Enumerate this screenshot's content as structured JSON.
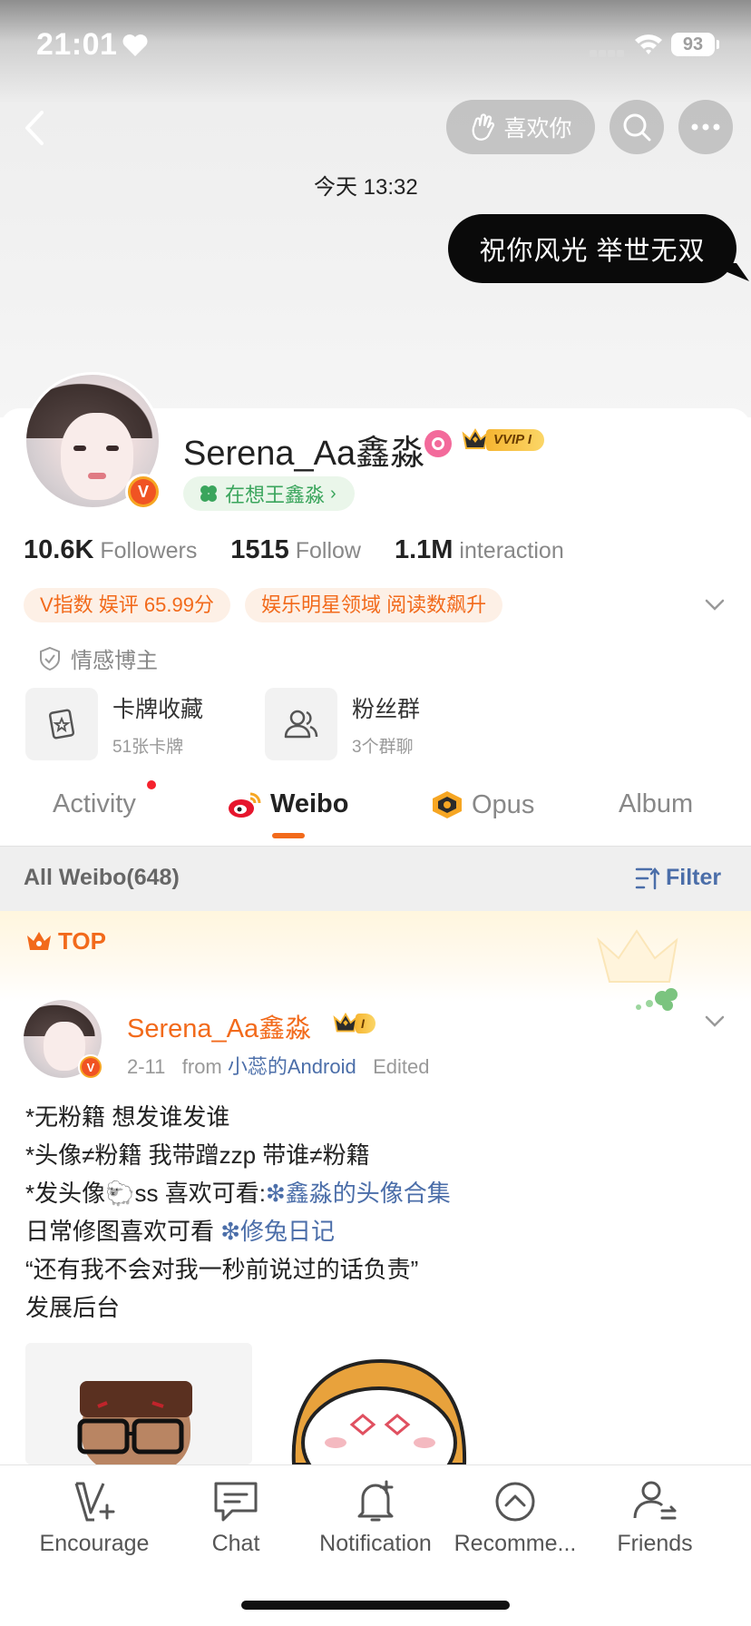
{
  "status_bar": {
    "time": "21:01",
    "battery": "93"
  },
  "nav": {
    "like_label": "喜欢你"
  },
  "chat": {
    "timestamp": "今天 13:32",
    "message": "祝你风光 举世无双"
  },
  "profile": {
    "name": "Serena_Aa鑫淼",
    "vip_label": "VVIP",
    "vip_level": "I",
    "thinking_label": "在想王鑫淼",
    "stats": [
      {
        "value": "10.6K",
        "label": "Followers"
      },
      {
        "value": "1515",
        "label": "Follow"
      },
      {
        "value": "1.1M",
        "label": "interaction"
      }
    ],
    "chips": [
      "V指数 娱评 65.99分",
      "娱乐明星领域 阅读数飙升"
    ],
    "tagline": "情感博主",
    "features": [
      {
        "title": "卡牌收藏",
        "sub": "51张卡牌",
        "icon": "card-icon"
      },
      {
        "title": "粉丝群",
        "sub": "3个群聊",
        "icon": "group-icon"
      }
    ]
  },
  "tabs": [
    "Activity",
    "Weibo",
    "Opus",
    "Album"
  ],
  "active_tab": "Weibo",
  "filter_bar": {
    "all_label": "All Weibo(648)",
    "filter_label": "Filter"
  },
  "top_label": "TOP",
  "post": {
    "author": "Serena_Aa鑫淼",
    "level": "I",
    "date": "2-11",
    "from_label": "from",
    "source": "小蕊的Android",
    "edited": "Edited",
    "lines": [
      "*无粉籍 想发谁发谁",
      "*头像≠粉籍 我带蹭zzp 带谁≠粉籍",
      "*发头像🐑ss 喜欢可看:",
      "日常修图喜欢可看",
      "“还有我不会对我一秒前说过的话负责”",
      "发展后台"
    ],
    "link1": "鑫淼的头像合集",
    "link2": "修兔日记"
  },
  "bottom_tabs": [
    "Encourage",
    "Chat",
    "Notification",
    "Recomme...",
    "Friends"
  ],
  "colors": {
    "accent": "#f26a1b",
    "link": "#4b6ea9",
    "green": "#3aa55c"
  }
}
